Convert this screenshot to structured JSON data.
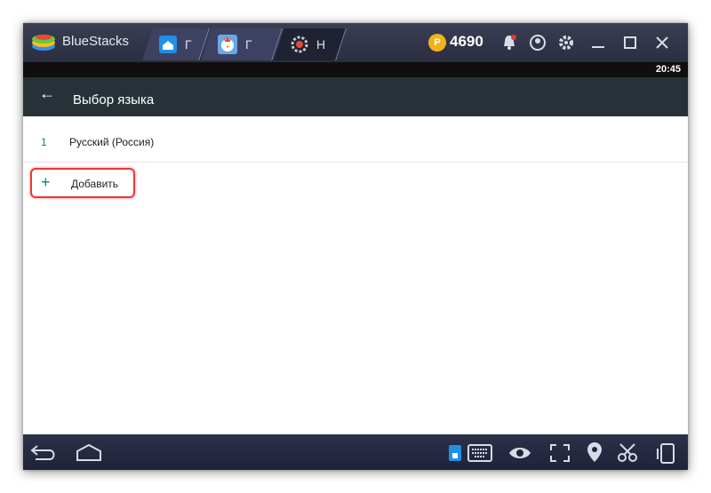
{
  "window": {
    "app_title": "BlueStacks",
    "tabs": [
      {
        "label": "Г",
        "icon": "home-icon"
      },
      {
        "label": "Г",
        "icon": "game-icon"
      },
      {
        "label": "Н",
        "icon": "settings-gear-icon"
      }
    ],
    "coins": "4690",
    "coin_glyph": "P"
  },
  "statusbar": {
    "time": "20:45"
  },
  "appbar": {
    "back_glyph": "←",
    "title": "Выбор языка"
  },
  "languages": [
    {
      "index": "1",
      "name": "Русский (Россия)"
    }
  ],
  "add_action": {
    "glyph": "+",
    "label": "Добавить"
  },
  "colors": {
    "accent": "#00897b",
    "highlight": "#e53935",
    "appbar": "#263238"
  }
}
